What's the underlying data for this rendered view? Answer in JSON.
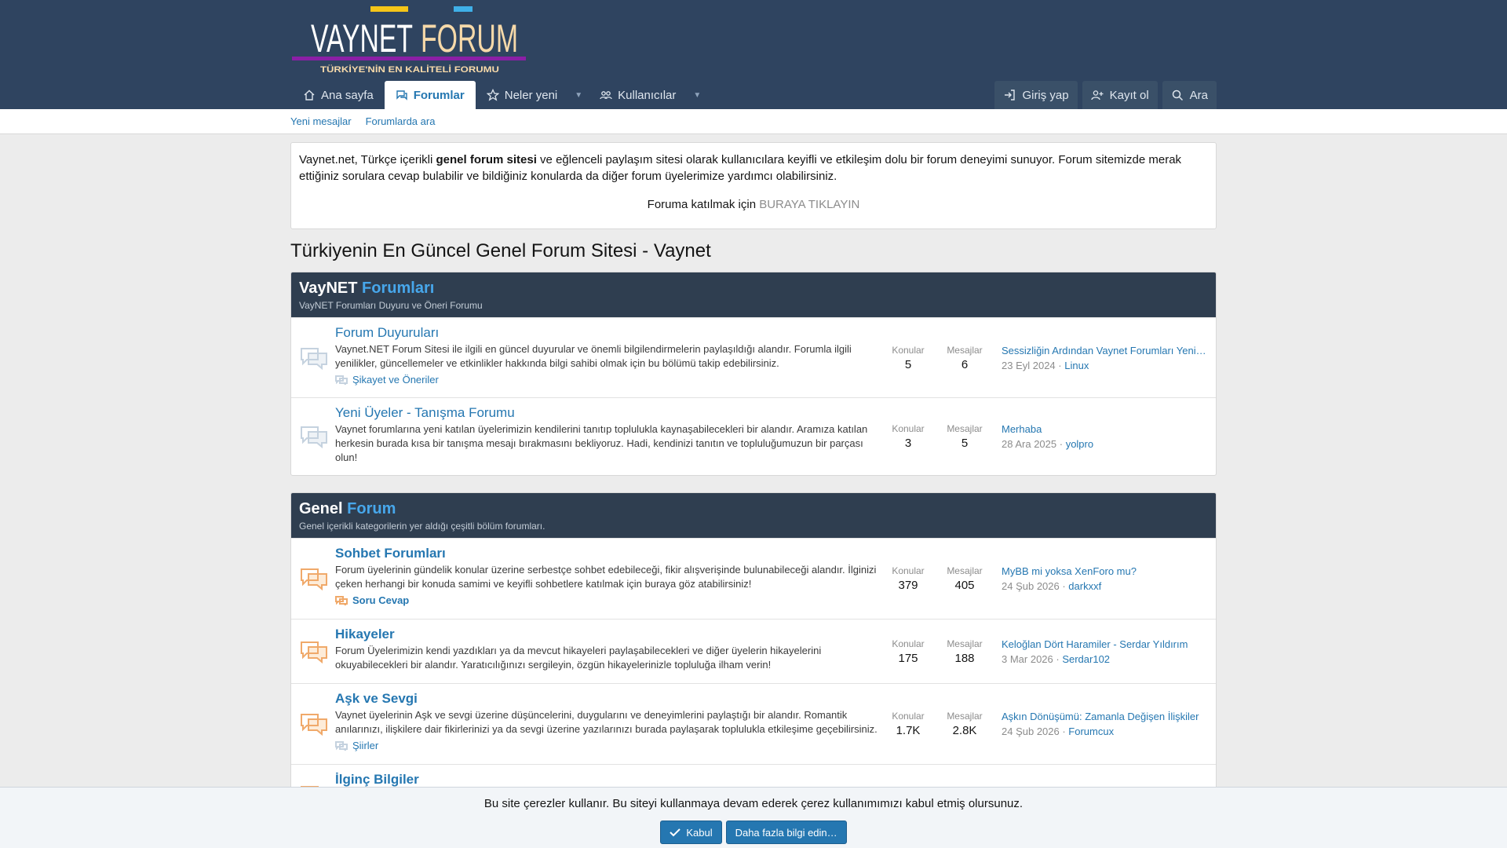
{
  "logo": {
    "main": "VAYNET",
    "accent": "FORUM",
    "tagline": "TÜRKİYE'NİN EN KALİTELİ FORUMU"
  },
  "nav": {
    "items": [
      {
        "label": "Ana sayfa",
        "icon": "home-icon"
      },
      {
        "label": "Forumlar",
        "icon": "chat-icon",
        "active": true
      },
      {
        "label": "Neler yeni",
        "icon": "star-icon"
      },
      {
        "label": "Kullanıcılar",
        "icon": "users-icon"
      }
    ],
    "login": "Giriş yap",
    "register": "Kayıt ol",
    "search": "Ara"
  },
  "subnav": {
    "new_posts": "Yeni mesajlar",
    "search_forums": "Forumlarda ara"
  },
  "notice": {
    "text_before": "Vaynet.net, Türkçe içerikli ",
    "text_bold": "genel forum sitesi",
    "text_after": " ve eğlenceli paylaşım sitesi olarak kullanıcılara keyifli ve etkileşim dolu bir forum deneyimi sunuyor. Forum sitemizde merak ettiğiniz sorulara cevap bulabilir ve bildiğiniz konularda da diğer forum üyelerimize yardımcı olabilirsiniz.",
    "join_text": "Foruma katılmak için ",
    "join_link": "BURAYA TIKLAYIN"
  },
  "page_title": "Türkiyenin En Güncel Genel Forum Sitesi - Vaynet",
  "blocks": [
    {
      "title_a": "VayNET",
      "title_b": "Forumları",
      "desc": "VayNET Forumları Duyuru ve Öneri Forumu",
      "nodes": [
        {
          "title": "Forum Duyuruları",
          "desc": "Vaynet.NET Forum Sitesi ile ilgili en güncel duyurular ve önemli bilgilendirmelerin paylaşıldığı alandır. Forumla ilgili yenilikler, güncellemeler ve etkinlikler hakkında bilgi sahibi olmak için bu bölümü takip edebilirsiniz.",
          "sub": "Şikayet ve Öneriler",
          "topics_label": "Konular",
          "topics": "5",
          "posts_label": "Mesajlar",
          "posts": "6",
          "last_title": "Sessizliğin Ardından Vaynet Forumları Yeniden...",
          "last_date": "23 Eyl 2024",
          "last_user": "Linux"
        },
        {
          "title": "Yeni Üyeler - Tanışma Forumu",
          "desc": "Vaynet forumlarına yeni katılan üyelerimizin kendilerini tanıtıp toplulukla kaynaşabilecekleri bir alandır. Aramıza katılan herkesin burada kısa bir tanışma mesajı bırakmasını bekliyoruz. Hadi, kendinizi tanıtın ve topluluğumuzun bir parçası olun!",
          "topics_label": "Konular",
          "topics": "3",
          "posts_label": "Mesajlar",
          "posts": "5",
          "last_title": "Merhaba",
          "last_date": "28 Ara 2025",
          "last_user": "yolpro"
        }
      ]
    },
    {
      "title_a": "Genel",
      "title_b": "Forum",
      "desc": "Genel içerikli kategorilerin yer aldığı çeşitli bölüm forumları.",
      "nodes": [
        {
          "title": "Sohbet Forumları",
          "desc": "Forum üyelerinin gündelik konular üzerine serbestçe sohbet edebileceği, fikir alışverişinde bulunabileceği alandır. İlginizi çeken herhangi bir konuda samimi ve keyifli sohbetlere katılmak için buraya göz atabilirsiniz!",
          "sub": "Soru Cevap",
          "topics_label": "Konular",
          "topics": "379",
          "posts_label": "Mesajlar",
          "posts": "405",
          "last_title": "MyBB mi yoksa XenForo mu?",
          "last_date": "24 Şub 2026",
          "last_user": "darkxxf"
        },
        {
          "title": "Hikayeler",
          "desc": "Forum Üyelerimizin kendi yazdıkları ya da mevcut hikayeleri paylaşabilecekleri ve diğer üyelerin hikayelerini okuyabilecekleri bir alandır. Yaratıcılığınızı sergileyin, özgün hikayelerinizle topluluğa ilham verin!",
          "topics_label": "Konular",
          "topics": "175",
          "posts_label": "Mesajlar",
          "posts": "188",
          "last_title": "Keloğlan Dört Haramiler - Serdar Yıldırım",
          "last_date": "3 Mar 2026",
          "last_user": "Serdar102"
        },
        {
          "title": "Aşk ve Sevgi",
          "desc": "Vaynet üyelerinin Aşk ve sevgi üzerine düşüncelerini, duygularını ve deneyimlerini paylaştığı bir alandır. Romantik anılarınızı, ilişkilere dair fikirlerinizi ya da sevgi üzerine yazılarınızı burada paylaşarak toplulukla etkileşime geçebilirsiniz.",
          "sub": "Şiirler",
          "topics_label": "Konular",
          "topics": "1.7K",
          "posts_label": "Mesajlar",
          "posts": "2.8K",
          "last_title": "Aşkın Dönüşümü: Zamanla Değişen İlişkiler",
          "last_date": "24 Şub 2026",
          "last_user": "Forumcux"
        },
        {
          "title": "İlginç Bilgiler"
        }
      ]
    }
  ],
  "cookie": {
    "text": "Bu site çerezler kullanır. Bu siteyi kullanmaya devam ederek çerez kullanımımızı kabul etmiş olursunuz.",
    "accept": "Kabul",
    "more": "Daha fazla bilgi edin…"
  },
  "colors": {
    "header": "#2f4460",
    "accent": "#2577b1",
    "block_head": "#2f3e50",
    "logo_bar": "#8b1fa6"
  }
}
